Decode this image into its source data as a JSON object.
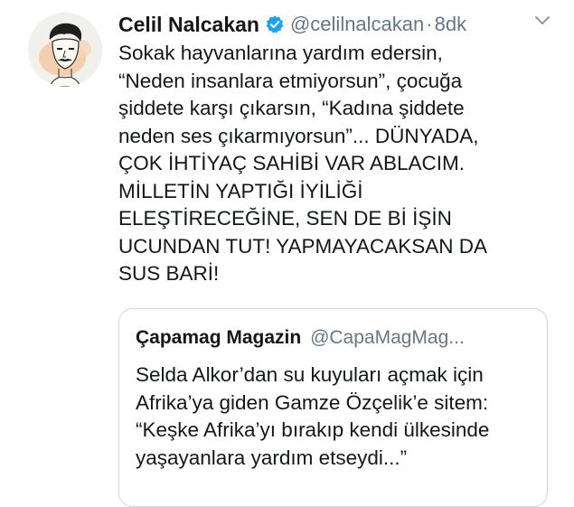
{
  "tweet": {
    "display_name": "Celil Nalcakan",
    "handle": "@celilnalcakan",
    "separator": "·",
    "timestamp": "8dk",
    "text": "Sokak hayvanlarına yardım edersin,\n“Neden insanlara etmiyorsun”, çocuğa\nşiddete karşı çıkarsın, “Kadına şiddete\nneden ses çıkarmıyorsun”... DÜNYADA,\nÇOK İHTİYAÇ SAHİBİ VAR ABLACIM.\nMİLLETİN YAPTIĞI İYİLİĞİ\nELEŞTİRECEĞİNE, SEN DE Bİ İŞİN\nUCUNDAN TUT! YAPMAYACAKSAN DA\nSUS BARİ!",
    "icons": {
      "avatar": "cartoon-portrait-avatar",
      "verified": "verified-badge-icon",
      "menu": "chevron-down-icon"
    },
    "colors": {
      "verified": "#1da1f2",
      "secondary_text": "#657786",
      "border": "#ccd6dd"
    }
  },
  "quote": {
    "display_name": "Çapamag Magazin",
    "handle": "@CapaMagMag...",
    "text": "Selda Alkor’dan su kuyuları açmak için\nAfrika’ya giden Gamze Özçelik’e sitem:\n“Keşke Afrika’yı bırakıp kendi ülkesinde\nyaşayanlara yardım etseydi...”"
  }
}
